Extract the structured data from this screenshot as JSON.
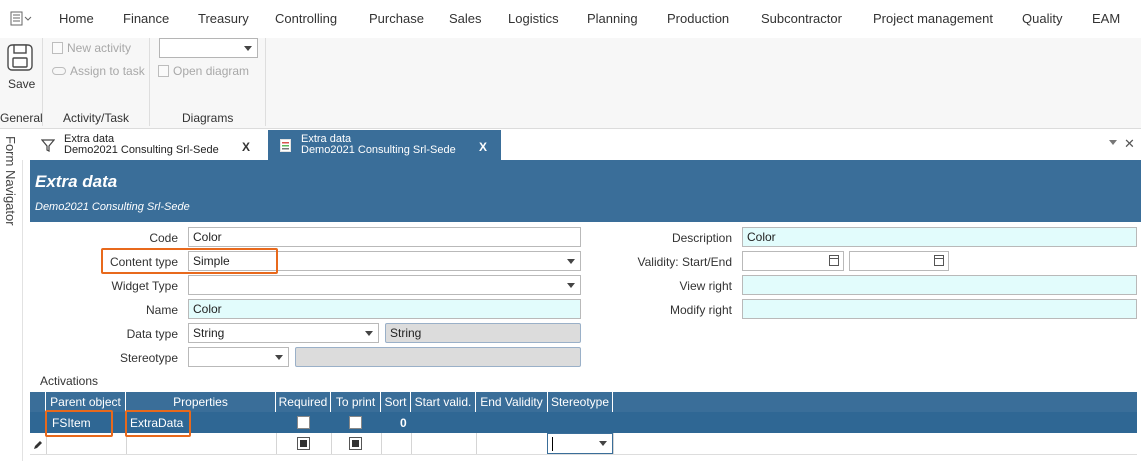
{
  "menu": [
    "Home",
    "Finance",
    "Treasury",
    "Controlling",
    "Purchase",
    "Sales",
    "Logistics",
    "Planning",
    "Production",
    "Subcontractor",
    "Project management",
    "Quality",
    "EAM"
  ],
  "ribbon": {
    "save_label": "Save",
    "new_activity": "New activity",
    "assign_to_task": "Assign to task",
    "open_diagram": "Open diagram",
    "diagram_select_value": "",
    "groups": {
      "general": "General",
      "activity_task": "Activity/Task",
      "diagrams": "Diagrams"
    }
  },
  "form_navigator_label": "Form Navigator",
  "tabs": [
    {
      "title": "Extra data",
      "subtitle": "Demo2021 Consulting Srl-Sede",
      "close": "X"
    },
    {
      "title": "Extra data",
      "subtitle": "Demo2021 Consulting Srl-Sede",
      "close": "X"
    }
  ],
  "header": {
    "title": "Extra data",
    "subtitle": "Demo2021 Consulting Srl-Sede"
  },
  "fields": {
    "code": {
      "label": "Code",
      "value": "Color"
    },
    "content_type": {
      "label": "Content type",
      "value": "Simple"
    },
    "widget_type": {
      "label": "Widget Type",
      "value": ""
    },
    "name": {
      "label": "Name",
      "value": "Color"
    },
    "data_type": {
      "label": "Data type",
      "value": "String",
      "extra": "String"
    },
    "stereotype": {
      "label": "Stereotype",
      "value": ""
    },
    "description": {
      "label": "Description",
      "value": "Color"
    },
    "validity": {
      "label": "Validity: Start/End",
      "start": "",
      "end": ""
    },
    "view_right": {
      "label": "View right",
      "value": ""
    },
    "modify_right": {
      "label": "Modify right",
      "value": ""
    }
  },
  "activations": {
    "label": "Activations",
    "columns": [
      "Parent object",
      "Properties",
      "Required",
      "To print",
      "Sort",
      "Start valid.",
      "End Validity",
      "Stereotype"
    ],
    "rows": [
      {
        "parent_object": "FSItem",
        "properties": "ExtraData",
        "required": false,
        "to_print": false,
        "sort": "0",
        "start_valid": "",
        "end_validity": "",
        "stereotype": ""
      }
    ]
  },
  "colors": {
    "header_blue": "#3a6e99",
    "cyan_field": "#e2fcfc",
    "highlight": "#e8691c"
  }
}
